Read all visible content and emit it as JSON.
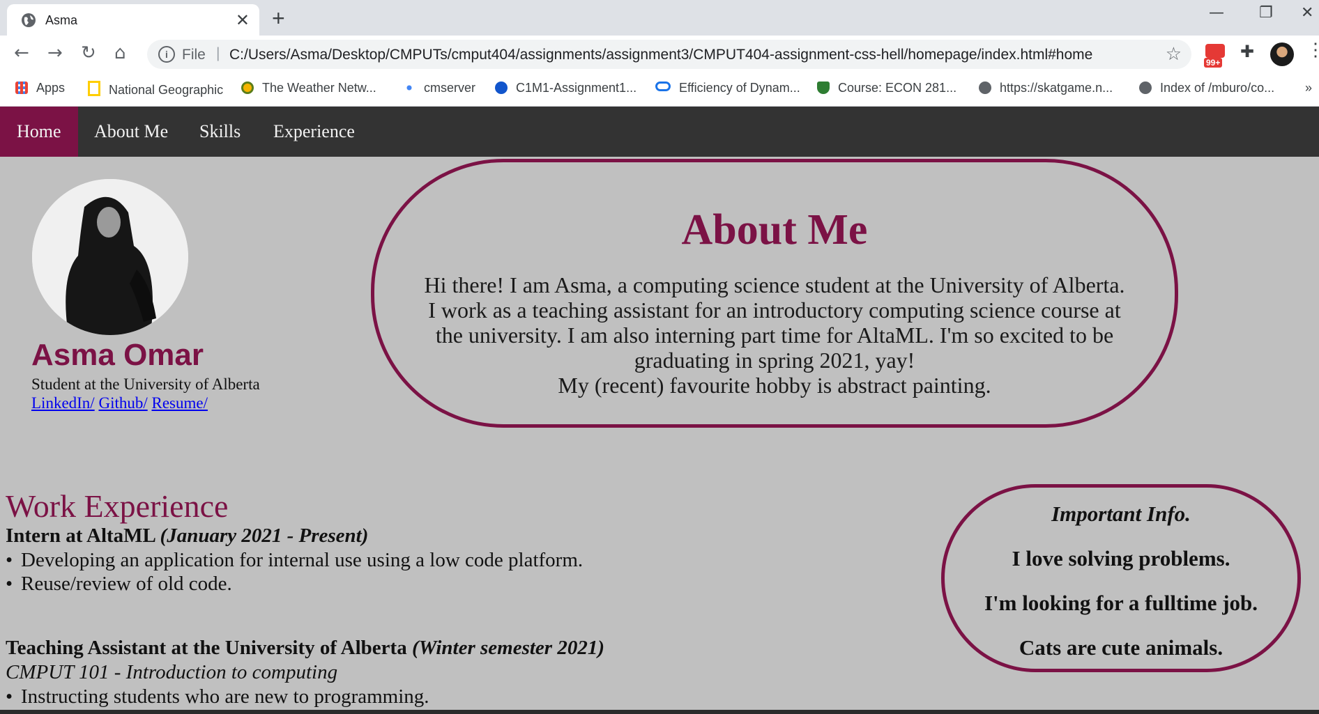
{
  "browser": {
    "tab_title": "Asma",
    "tab_close": "✕",
    "new_tab": "+",
    "window": {
      "minimize": "—",
      "restore": "❐",
      "close": "✕"
    },
    "nav": {
      "back": "←",
      "forward": "→",
      "reload": "↻",
      "home": "⌂"
    },
    "address": {
      "info": "i",
      "scheme": "File",
      "separator": "|",
      "url": "C:/Users/Asma/Desktop/CMPUTs/cmput404/assignments/assignment3/CMPUT404-assignment-css-hell/homepage/index.html#home",
      "star": "☆"
    },
    "extensions": {
      "badge": "99+",
      "puzzle": "✚",
      "menu": "⋮"
    },
    "bookmarks": [
      {
        "label": "Apps",
        "icon": "apps-grid-icon",
        "color": "#4285f4"
      },
      {
        "label": "National Geographic",
        "icon": "natgeo-icon",
        "color": "#ffce00"
      },
      {
        "label": "The Weather Netw...",
        "icon": "weather-icon",
        "color": "#f4b400"
      },
      {
        "label": "cmserver",
        "icon": "cmserver-icon",
        "color": "#4285f4"
      },
      {
        "label": "C1M1-Assignment1...",
        "icon": "coursera-icon",
        "color": "#1155cc"
      },
      {
        "label": "Efficiency of Dynam...",
        "icon": "infinity-icon",
        "color": "#1a73e8"
      },
      {
        "label": "Course: ECON 281...",
        "icon": "shield-icon",
        "color": "#2e7d32"
      },
      {
        "label": "https://skatgame.n...",
        "icon": "globe-icon",
        "color": "#5f6368"
      },
      {
        "label": "Index of /mburo/co...",
        "icon": "globe-icon",
        "color": "#5f6368"
      }
    ],
    "bookmarks_more": "»"
  },
  "site": {
    "accent": "#7b1245",
    "nav": [
      {
        "label": "Home",
        "active": true
      },
      {
        "label": "About Me",
        "active": false
      },
      {
        "label": "Skills",
        "active": false
      },
      {
        "label": "Experience",
        "active": false
      }
    ],
    "profile": {
      "name": "Asma Omar",
      "subtitle": "Student at the University of Alberta",
      "links": [
        "LinkedIn/",
        "Github/",
        "Resume/"
      ]
    },
    "about": {
      "heading": "About Me",
      "bio": "Hi there! I am Asma, a computing science student at the University of Alberta. I work as a teaching assistant for an introductory computing science course at the university. I am also interning part time for AltaML. I'm so excited to be graduating in spring 2021, yay!",
      "hobby": "My (recent) favourite hobby is abstract painting."
    },
    "work": {
      "heading": "Work Experience",
      "jobs": [
        {
          "title": "Intern at AltaML",
          "dates": "(January 2021 - Present)",
          "bullets": [
            "Developing an application for internal use using a low code platform.",
            "Reuse/review of old code."
          ]
        },
        {
          "title": "Teaching Assistant at the University of Alberta",
          "dates": "(Winter semester 2021)",
          "course": "CMPUT 101 - Introduction to computing",
          "bullets": [
            "Instructing students who are new to programming."
          ]
        }
      ]
    },
    "info": {
      "title": "Important Info.",
      "lines": [
        "I love solving problems.",
        "I'm looking for a fulltime job.",
        "Cats are cute animals."
      ]
    }
  }
}
